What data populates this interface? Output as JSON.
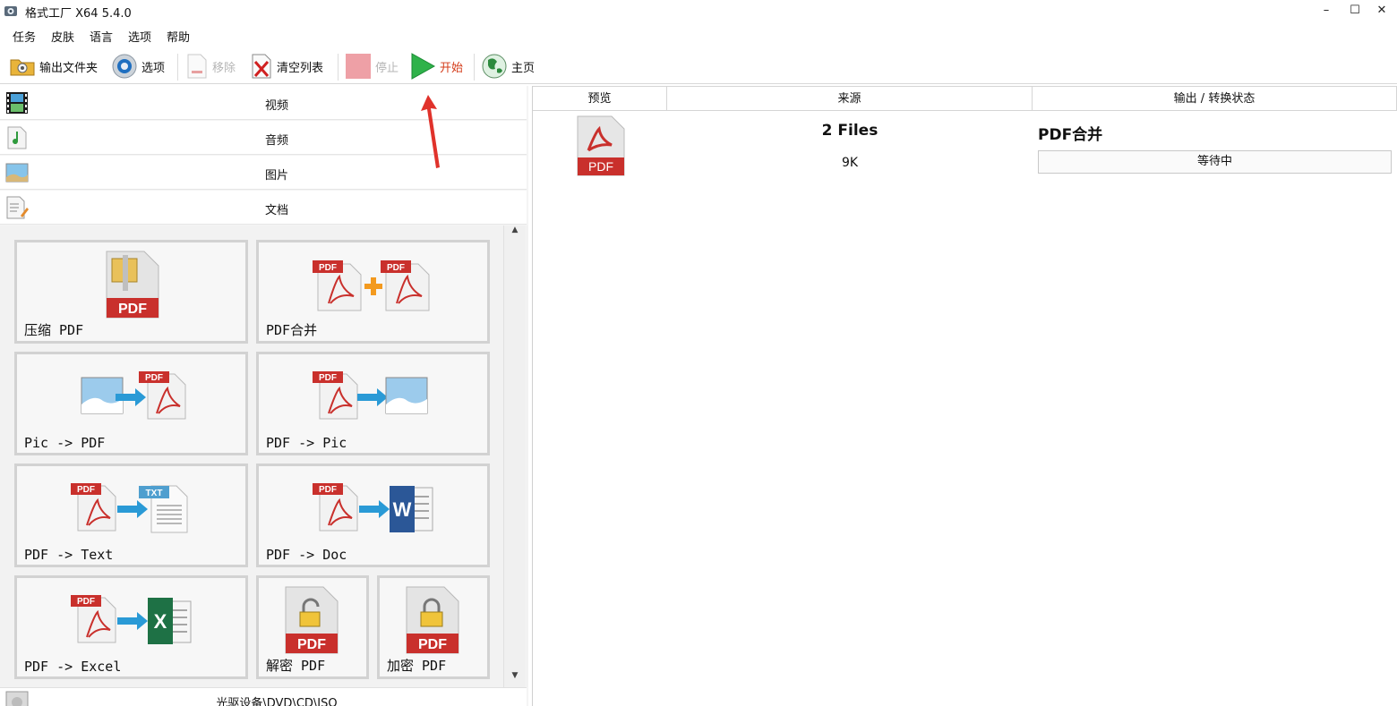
{
  "window": {
    "title": "格式工厂 X64 5.4.0",
    "minimize": "–",
    "maximize": "☐",
    "close": "✕"
  },
  "menu": [
    "任务",
    "皮肤",
    "语言",
    "选项",
    "帮助"
  ],
  "toolbar": {
    "output_folder": "输出文件夹",
    "options": "选项",
    "remove": "移除",
    "clear_list": "清空列表",
    "stop": "停止",
    "start": "开始",
    "home": "主页"
  },
  "categories": [
    "视频",
    "音频",
    "图片",
    "文档"
  ],
  "tiles": [
    "压缩 PDF",
    "PDF合并",
    "Pic -> PDF",
    "PDF -> Pic",
    "PDF -> Text",
    "PDF -> Doc",
    "PDF -> Excel",
    "解密 PDF",
    "加密 PDF"
  ],
  "bottom_category": "光驱设备\\DVD\\CD\\ISO",
  "icon_text": {
    "pdf": "PDF",
    "txt": "TXT",
    "word": "W",
    "excel": "X"
  },
  "table": {
    "headers": [
      "预览",
      "来源",
      "输出 / 转换状态"
    ],
    "rows": [
      {
        "preview_icon": "PDF",
        "source": "2 Files",
        "size": "9K",
        "output": "PDF合并",
        "status": "等待中"
      }
    ]
  },
  "colors": {
    "pdf_red": "#c9302c",
    "start_green": "#2fb24a",
    "start_label": "#d43c1a",
    "arrow_red": "#e0322b"
  }
}
